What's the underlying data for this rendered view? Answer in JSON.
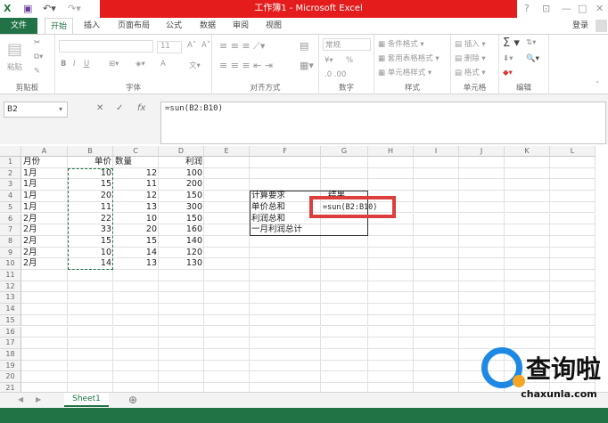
{
  "window": {
    "title": "工作簿1 - Microsoft Excel",
    "help": "?",
    "min": "—",
    "max": "□",
    "close": "✕"
  },
  "tabs": [
    "文件",
    "开始",
    "插入",
    "页面布局",
    "公式",
    "数据",
    "审阅",
    "视图"
  ],
  "login": "登录",
  "ribbon": {
    "clipboard": {
      "label": "剪贴板",
      "paste": "粘贴"
    },
    "font": {
      "label": "字体",
      "size": "11",
      "bold": "B",
      "italic": "I",
      "underline": "U",
      "grow": "A˄",
      "shrink": "A˅",
      "color": "A"
    },
    "align": {
      "label": "对齐方式"
    },
    "number": {
      "label": "数字",
      "format": "常规",
      "percent": "%"
    },
    "styles": {
      "label": "样式",
      "items": [
        "条件格式 ▾",
        "套用表格格式 ▾",
        "单元格样式 ▾"
      ]
    },
    "cells": {
      "label": "单元格",
      "items": [
        "插入 ▾",
        "删除 ▾",
        "格式 ▾"
      ]
    },
    "editing": {
      "label": "编辑",
      "sum": "Σ ▾"
    }
  },
  "formula_bar": {
    "name_box": "B2",
    "cancel": "✕",
    "enter": "✓",
    "fx": "fx",
    "formula": "=sun(B2:B10)"
  },
  "columns": [
    "A",
    "B",
    "C",
    "D",
    "E",
    "F",
    "G",
    "H",
    "I",
    "J",
    "K",
    "L"
  ],
  "rows": [
    "1",
    "2",
    "3",
    "4",
    "5",
    "6",
    "7",
    "8",
    "9",
    "10",
    "11",
    "12",
    "13",
    "14",
    "15",
    "16",
    "17",
    "18",
    "19",
    "20",
    "21"
  ],
  "table": {
    "headers": [
      "月份",
      "单价",
      "数量",
      "利润"
    ],
    "data": [
      [
        "1月",
        "10",
        "12",
        "100"
      ],
      [
        "1月",
        "15",
        "11",
        "200"
      ],
      [
        "1月",
        "20",
        "12",
        "150"
      ],
      [
        "1月",
        "11",
        "13",
        "300"
      ],
      [
        "2月",
        "22",
        "10",
        "150"
      ],
      [
        "2月",
        "33",
        "20",
        "160"
      ],
      [
        "2月",
        "15",
        "15",
        "140"
      ],
      [
        "2月",
        "10",
        "14",
        "120"
      ],
      [
        "2月",
        "14",
        "13",
        "130"
      ]
    ]
  },
  "calc": {
    "req_header": "计算要求",
    "result_header": "结果",
    "items": [
      "单价总和",
      "利润总和",
      "一月利润总计"
    ],
    "formula_cell": "=sun(B2:B10)"
  },
  "sheets": [
    "Sheet1"
  ],
  "add_sheet": "⊕",
  "watermark": {
    "brand": "查询啦",
    "url": "chaxunla.com"
  },
  "colors": {
    "excel_green": "#217346",
    "title_red": "#e51c1c",
    "highlight": "#dc3d3d"
  }
}
